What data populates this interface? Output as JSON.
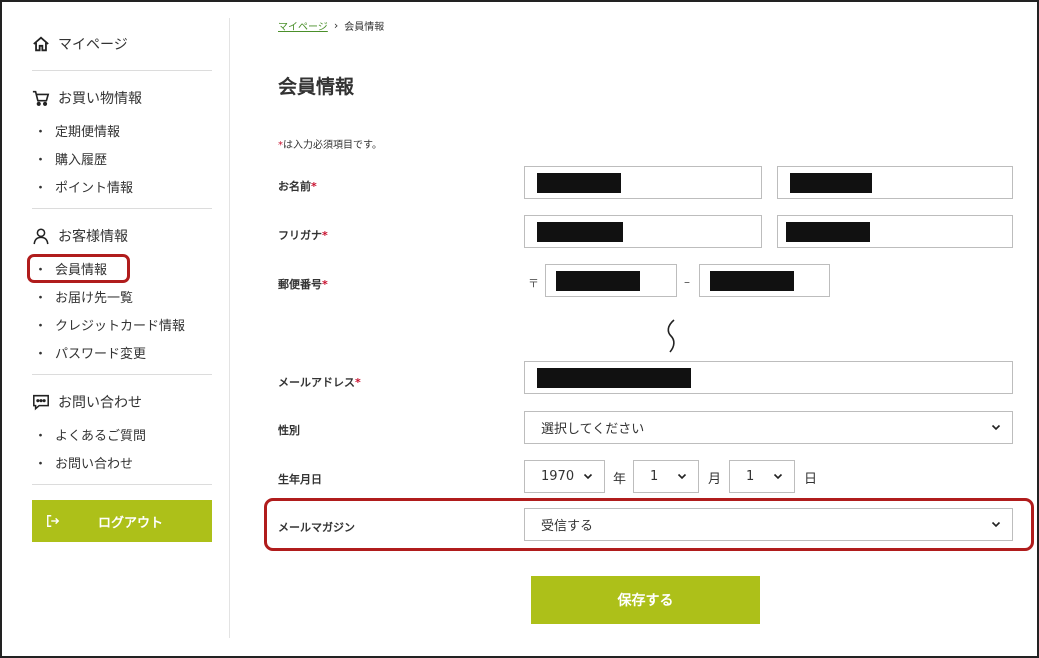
{
  "sidebar": {
    "mypage": "マイページ",
    "shopping": {
      "title": "お買い物情報",
      "items": [
        "定期便情報",
        "購入履歴",
        "ポイント情報"
      ]
    },
    "customer": {
      "title": "お客様情報",
      "items": [
        "会員情報",
        "お届け先一覧",
        "クレジットカード情報",
        "パスワード変更"
      ]
    },
    "contact": {
      "title": "お問い合わせ",
      "items": [
        "よくあるご質問",
        "お問い合わせ"
      ]
    },
    "logout": "ログアウト",
    "bullet": "・"
  },
  "breadcrumb": {
    "home": "マイページ",
    "separator": "›",
    "current": "会員情報"
  },
  "page_title": "会員情報",
  "required_note": {
    "star": "*",
    "text": "は入力必須項目です。"
  },
  "form": {
    "name_label": "お名前",
    "furigana_label": "フリガナ",
    "postal_label": "郵便番号",
    "postal_mark": "〒",
    "postal_dash": "–",
    "email_label": "メールアドレス",
    "gender_label": "性別",
    "gender_value": "選択してください",
    "birth_label": "生年月日",
    "birth_year": "1970",
    "year_unit": "年",
    "birth_month": "1",
    "month_unit": "月",
    "birth_day": "1",
    "day_unit": "日",
    "magazine_label": "メールマガジン",
    "magazine_value": "受信する",
    "required_star": "*"
  },
  "save_button": "保存する",
  "colors": {
    "accent_green": "#adc019",
    "highlight_red": "#b01c1c",
    "required_red": "#c8102e",
    "link_green": "#4a8f2a"
  },
  "icons": {
    "mypage": "home-icon",
    "shopping": "cart-icon",
    "customer": "user-icon",
    "contact": "chat-icon",
    "logout": "logout-icon",
    "select": "chevron-down-icon"
  }
}
